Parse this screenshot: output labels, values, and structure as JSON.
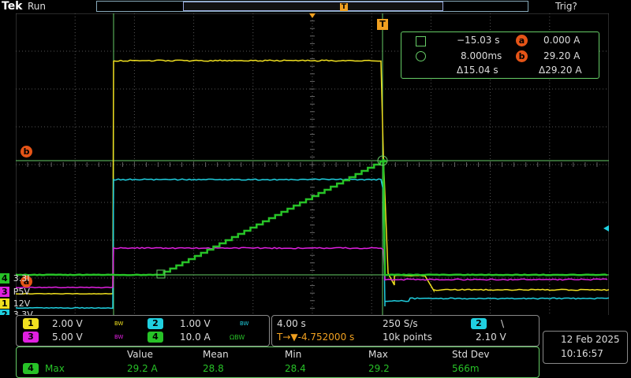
{
  "header": {
    "brand": "Tek",
    "acq_state": "Run",
    "trigger_state": "Trig?"
  },
  "trigger_marker": "T",
  "cursors": {
    "a_time": "−15.03 s",
    "b_time": "8.000ms",
    "delta_time": "Δ15.04 s",
    "a_value": "0.000 A",
    "b_value": "29.20 A",
    "delta_value": "Δ29.20 A",
    "a_label": "a",
    "b_label": "b"
  },
  "channel_markers": [
    {
      "num": "4",
      "text": "3.3I",
      "color": "#27c227"
    },
    {
      "num": "3",
      "text": "P5V",
      "color": "#e020e0"
    },
    {
      "num": "1",
      "text": "12V",
      "color": "#f0e020"
    },
    {
      "num": "2",
      "text": "3.3V",
      "color": "#20d0e0"
    }
  ],
  "channels": {
    "ch1": {
      "num": "1",
      "scale": "2.00 V",
      "bw": "BW",
      "color": "#f0e020"
    },
    "ch2": {
      "num": "2",
      "scale": "1.00 V",
      "bw": "BW",
      "color": "#20d0e0"
    },
    "ch3": {
      "num": "3",
      "scale": "5.00 V",
      "bw": "BW",
      "color": "#e020e0"
    },
    "ch4": {
      "num": "4",
      "scale": "10.0 A",
      "bw": "ΩBW",
      "color": "#27c227"
    }
  },
  "horizontal": {
    "timebase": "4.00 s",
    "sample_rate": "250 S/s",
    "trigger_position": "T→▼-4.752000 s",
    "record_length": "10k points"
  },
  "trigger": {
    "source": "2",
    "slope": "\\",
    "level": "2.10 V"
  },
  "datetime": {
    "date": "12 Feb  2025",
    "time": "10:16:57"
  },
  "measurement": {
    "headers": [
      "Value",
      "Mean",
      "Min",
      "Max",
      "Std Dev"
    ],
    "channel": "4",
    "name": "Max",
    "values": [
      "29.2 A",
      "28.8",
      "28.4",
      "29.2",
      "566m"
    ]
  },
  "colors": {
    "ch1": "#f0e020",
    "ch2": "#20d0e0",
    "ch3": "#e020e0",
    "ch4": "#27c227",
    "cursor": "#6c6",
    "orange": "#e55417",
    "grid": "#555"
  }
}
